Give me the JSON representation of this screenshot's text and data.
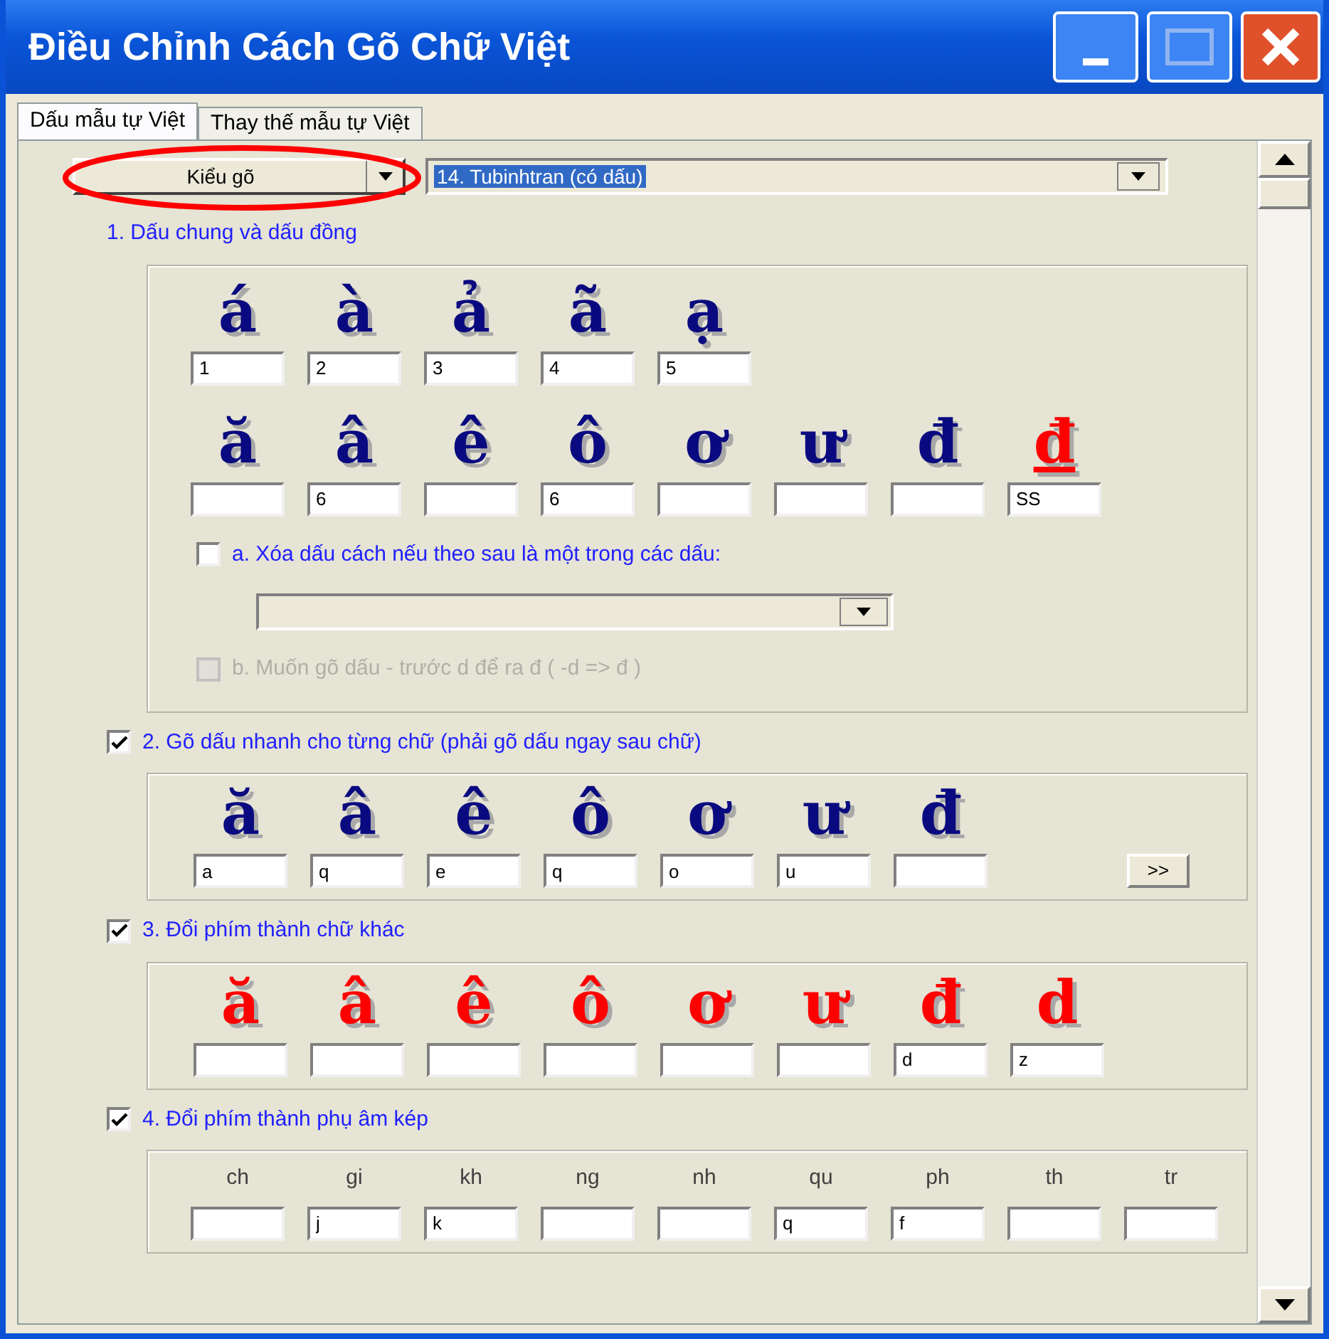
{
  "window": {
    "title": "Điều Chỉnh Cách Gõ Chữ Việt"
  },
  "tabs": [
    {
      "label": "Dấu mẫu tự Việt",
      "selected": true
    },
    {
      "label": "Thay thế mẫu tự Việt",
      "selected": false
    }
  ],
  "mode_dropdown": {
    "value": "Kiểu gõ"
  },
  "scheme_dropdown": {
    "value": "14. Tubinhtran (có dấu)"
  },
  "section_1": {
    "title": "1. Dấu chung và dấu đồng",
    "rows": [
      [
        {
          "glyph": "á",
          "value": "1",
          "color": "#0a0a80",
          "underline": false
        },
        {
          "glyph": "à",
          "value": "2",
          "color": "#0a0a80",
          "underline": false
        },
        {
          "glyph": "ả",
          "value": "3",
          "color": "#0a0a80",
          "underline": false
        },
        {
          "glyph": "ã",
          "value": "4",
          "color": "#0a0a80",
          "underline": false
        },
        {
          "glyph": "ạ",
          "value": "5",
          "color": "#0a0a80",
          "underline": false
        }
      ],
      [
        {
          "glyph": "ă",
          "color": "#0a0a80",
          "underline": false
        },
        {
          "glyph": "â",
          "value": "6",
          "color": "#0a0a80",
          "underline": false
        },
        {
          "glyph": "ê",
          "color": "#0a0a80",
          "underline": false
        },
        {
          "glyph": "ô",
          "value": "6",
          "color": "#0a0a80",
          "underline": false
        },
        {
          "glyph": "ơ",
          "color": "#0a0a80",
          "underline": false
        },
        {
          "glyph": "ư",
          "color": "#0a0a80",
          "underline": false
        },
        {
          "glyph": "đ",
          "color": "#0a0a80",
          "underline": false
        },
        {
          "glyph": "đ",
          "value": "SS",
          "color": "#ff0000",
          "underline": true
        }
      ]
    ],
    "option_a": {
      "label": "a. Xóa dấu cách nếu theo sau là một trong các dấu:",
      "checked": false,
      "disabled": false
    },
    "option_b": {
      "label": "b. Muốn gõ dấu - trước d để ra đ ( -d => đ )",
      "checked": false,
      "disabled": true
    }
  },
  "section_2": {
    "title": "2. Gõ dấu nhanh cho từng chữ (phải gõ dấu ngay sau chữ)",
    "checked": true,
    "items": [
      {
        "glyph": "ă",
        "value": "a"
      },
      {
        "glyph": "â",
        "value": "q"
      },
      {
        "glyph": "ê",
        "value": "e"
      },
      {
        "glyph": "ô",
        "value": "q"
      },
      {
        "glyph": "ơ",
        "value": "o"
      },
      {
        "glyph": "ư",
        "value": "u"
      },
      {
        "glyph": "đ"
      }
    ],
    "more_button": ">>"
  },
  "section_3": {
    "title": "3. Đổi phím thành chữ khác",
    "checked": true,
    "items": [
      {
        "glyph": "ă"
      },
      {
        "glyph": "â"
      },
      {
        "glyph": "ê"
      },
      {
        "glyph": "ô"
      },
      {
        "glyph": "ơ"
      },
      {
        "glyph": "ư"
      },
      {
        "glyph": "đ",
        "value": "d"
      },
      {
        "glyph": "d",
        "value": "z"
      }
    ]
  },
  "section_4": {
    "title": "4. Đổi phím thành phụ âm kép",
    "checked": true,
    "items": [
      {
        "label": "ch"
      },
      {
        "label": "gi",
        "value": "j"
      },
      {
        "label": "kh",
        "value": "k"
      },
      {
        "label": "ng"
      },
      {
        "label": "nh"
      },
      {
        "label": "qu",
        "value": "q"
      },
      {
        "label": "ph",
        "value": "f"
      },
      {
        "label": "th"
      },
      {
        "label": "tr"
      }
    ]
  }
}
